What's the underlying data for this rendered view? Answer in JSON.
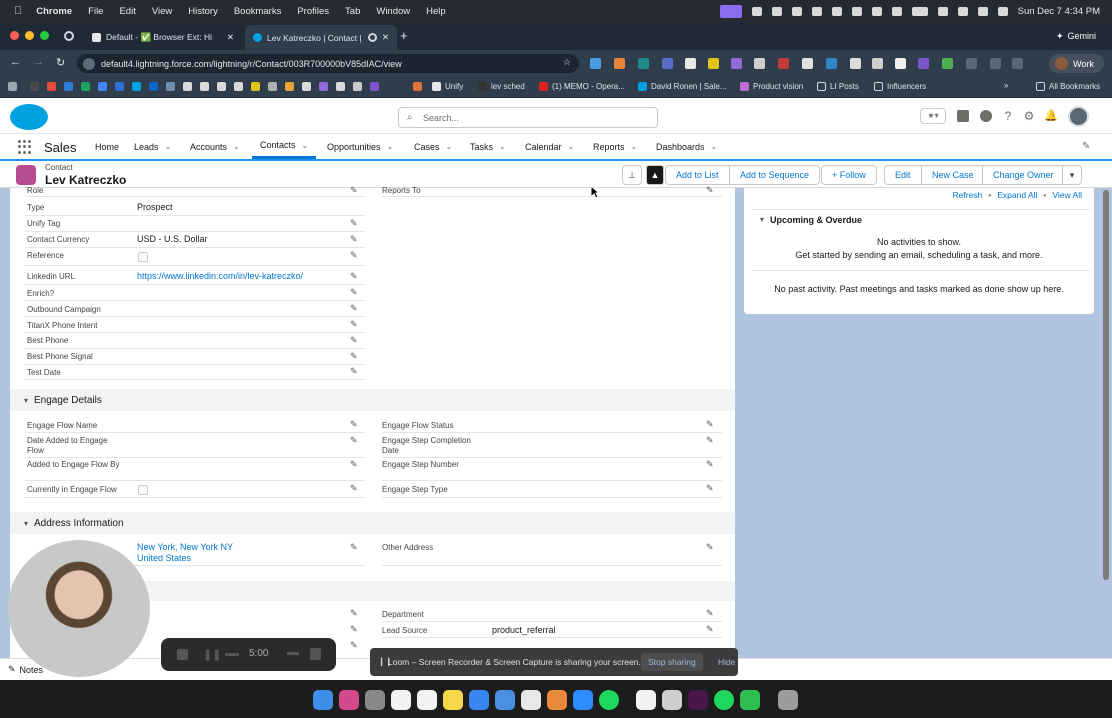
{
  "menubar": {
    "app": "Chrome",
    "items": [
      "File",
      "Edit",
      "View",
      "History",
      "Bookmarks",
      "Profiles",
      "Tab",
      "Window",
      "Help"
    ],
    "datetime": "Sun Dec 7  4:34 PM"
  },
  "tabs": [
    {
      "label": "Default - ✅ Browser Ext: Hi"
    },
    {
      "label": "Lev Katreczko | Contact |"
    }
  ],
  "gemini_label": "Gemini",
  "omnibox": {
    "url": "default4.lightning.force.com/lightning/r/Contact/003R700000bV85dIAC/view"
  },
  "profile_label": "Work",
  "bookmarks": {
    "items": [
      "Unify",
      "lev sched",
      "(1) MEMO - Opera...",
      "David Ronen | Sale...",
      "Product vision",
      "LI Posts",
      "Influencers"
    ],
    "all_label": "All Bookmarks"
  },
  "sf": {
    "search_placeholder": "Search...",
    "app_name": "Sales",
    "nav": [
      "Home",
      "Leads",
      "Accounts",
      "Contacts",
      "Opportunities",
      "Cases",
      "Tasks",
      "Calendar",
      "Reports",
      "Dashboards"
    ]
  },
  "record": {
    "object": "Contact",
    "name": "Lev Katreczko",
    "buttons": [
      "Add to List",
      "Add to Sequence",
      "+ Follow",
      "Edit",
      "New Case",
      "Change Owner"
    ]
  },
  "fields_left": [
    {
      "label": "Role",
      "value": ""
    },
    {
      "label": "Type",
      "value": "Prospect"
    },
    {
      "label": "Unify Tag",
      "value": ""
    },
    {
      "label": "Contact Currency",
      "value": "USD - U.S. Dollar"
    },
    {
      "label": "Reference",
      "value": ""
    },
    {
      "label": "Linkedin URL",
      "value": "https://www.linkedin.com/in/lev-katreczko/"
    },
    {
      "label": "Enrich?",
      "value": ""
    },
    {
      "label": "Outbound Campaign",
      "value": ""
    },
    {
      "label": "TitanX Phone Intent",
      "value": ""
    },
    {
      "label": "Best Phone",
      "value": ""
    },
    {
      "label": "Best Phone Signal",
      "value": ""
    },
    {
      "label": "Test Date",
      "value": ""
    }
  ],
  "reports_to_label": "Reports To",
  "engage": {
    "title": "Engage Details",
    "left": [
      "Engage Flow Name",
      "Date Added to Engage Flow",
      "Added to Engage Flow By",
      "Currently in Engage Flow"
    ],
    "right": [
      "Engage Flow Status",
      "Engage Step Completion Date",
      "Engage Step Number",
      "Engage Step Type"
    ]
  },
  "address": {
    "title": "Address Information",
    "mailing_value_line1": "New York, New York NY",
    "mailing_value_line2": "United States",
    "other_label": "Other Address"
  },
  "extra_fields": {
    "department_label": "Department",
    "lead_source_label": "Lead Source",
    "lead_source_value": "product_referral"
  },
  "activity": {
    "links": [
      "Refresh",
      "Expand All",
      "View All"
    ],
    "upcoming_title": "Upcoming & Overdue",
    "no_activities": "No activities to show.",
    "get_started": "Get started by sending an email, scheduling a task, and more.",
    "no_past": "No past activity. Past meetings and tasks marked as done show up here."
  },
  "utility": {
    "notes_label": "Notes"
  },
  "loom": {
    "timer": "5:00",
    "share_message": "Loom – Screen Recorder & Screen Capture is sharing your screen.",
    "stop_label": "Stop sharing",
    "hide_label": "Hide"
  },
  "colors": {
    "accent": "#0176d3",
    "sf_cloud": "#00a1e0",
    "contact_icon": "#b74c8f",
    "page_bg": "#b0c4df"
  }
}
